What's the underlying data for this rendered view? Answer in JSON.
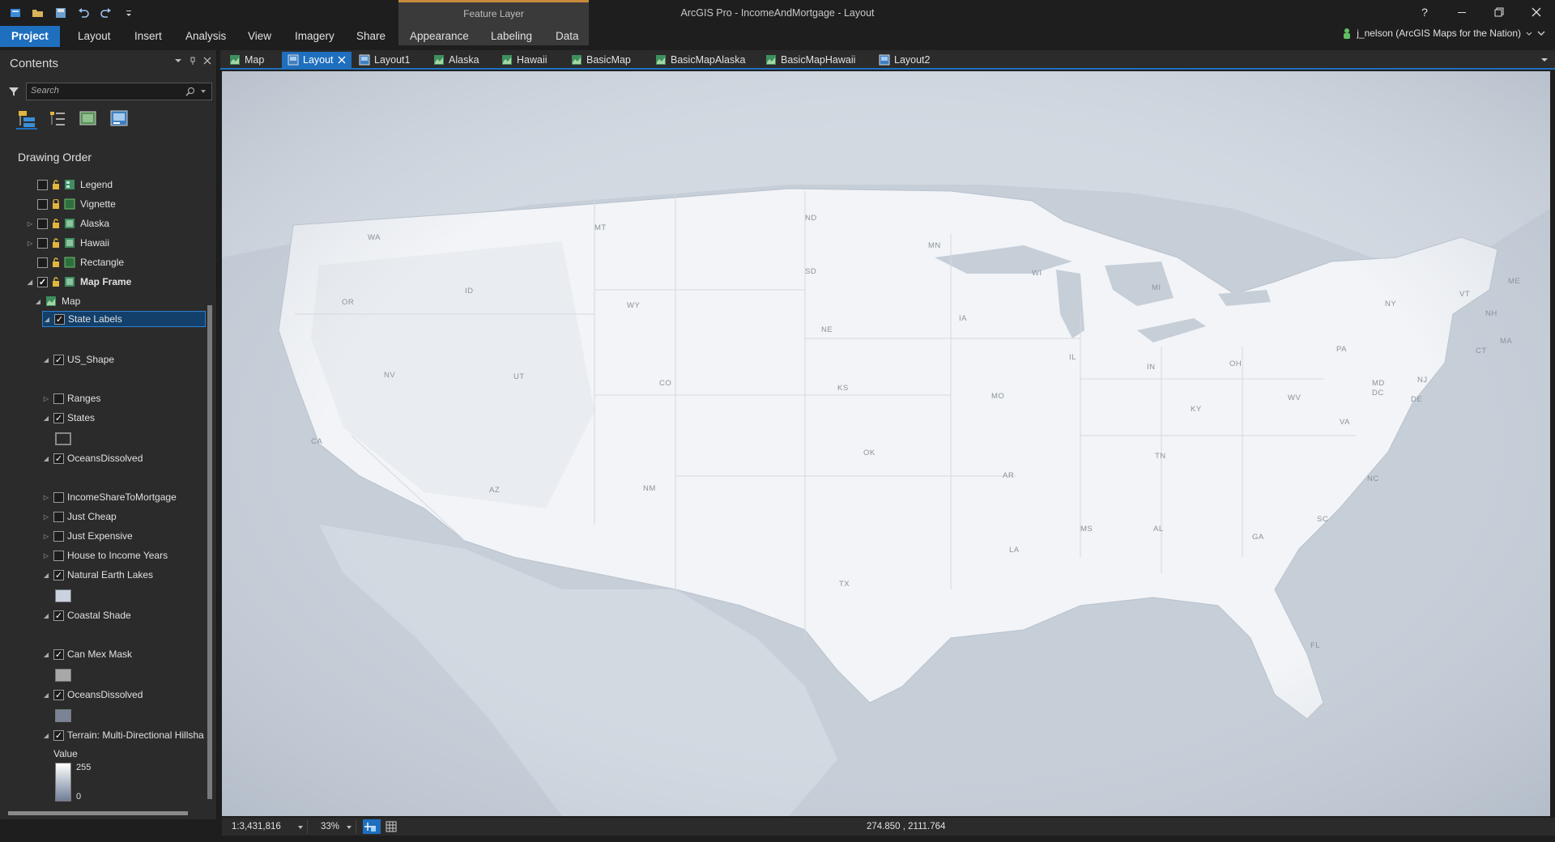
{
  "title_bar": {
    "app_title": "ArcGIS Pro - IncomeAndMortgage - Layout",
    "contextual_group": "Feature Layer",
    "help": "?"
  },
  "ribbon": {
    "tabs": [
      {
        "label": "Project",
        "active": true
      },
      {
        "label": "Layout"
      },
      {
        "label": "Insert"
      },
      {
        "label": "Analysis"
      },
      {
        "label": "View"
      },
      {
        "label": "Imagery"
      },
      {
        "label": "Share"
      },
      {
        "label": "Appearance"
      },
      {
        "label": "Labeling"
      },
      {
        "label": "Data"
      }
    ],
    "user": "j_nelson (ArcGIS Maps for the Nation)"
  },
  "contents": {
    "title": "Contents",
    "search_placeholder": "Search",
    "heading": "Drawing Order",
    "layers": [
      {
        "label": "Legend"
      },
      {
        "label": "Vignette"
      },
      {
        "label": "Alaska"
      },
      {
        "label": "Hawaii"
      },
      {
        "label": "Rectangle"
      },
      {
        "label": "Map Frame"
      },
      {
        "label": "Map"
      },
      {
        "label": "State Labels"
      },
      {
        "label": "US_Shape"
      },
      {
        "label": "Ranges"
      },
      {
        "label": "States"
      },
      {
        "label": "OceansDissolved"
      },
      {
        "label": "IncomeShareToMortgage"
      },
      {
        "label": "Just Cheap"
      },
      {
        "label": "Just Expensive"
      },
      {
        "label": "House to Income Years"
      },
      {
        "label": "Natural Earth Lakes"
      },
      {
        "label": "Coastal Shade"
      },
      {
        "label": "Can Mex Mask"
      },
      {
        "label": "OceansDissolved"
      },
      {
        "label": "Terrain: Multi-Directional Hillsha"
      }
    ],
    "legend_value_label": "Value",
    "legend_max": "255",
    "legend_min": "0"
  },
  "view_tabs": [
    {
      "label": "Map"
    },
    {
      "label": "Layout",
      "active": true
    },
    {
      "label": "Layout1"
    },
    {
      "label": "Alaska"
    },
    {
      "label": "Hawaii"
    },
    {
      "label": "BasicMap"
    },
    {
      "label": "BasicMapAlaska"
    },
    {
      "label": "BasicMapHawaii"
    },
    {
      "label": "Layout2"
    }
  ],
  "map": {
    "state_labels": [
      "WA",
      "MT",
      "ND",
      "MN",
      "OR",
      "ID",
      "WY",
      "SD",
      "WI",
      "MI",
      "NE",
      "IA",
      "NV",
      "UT",
      "CO",
      "IL",
      "IN",
      "OH",
      "PA",
      "NY",
      "VT",
      "NH",
      "ME",
      "MA",
      "CT",
      "NJ",
      "MD",
      "DE",
      "DC",
      "CA",
      "KS",
      "MO",
      "KY",
      "WV",
      "VA",
      "OK",
      "AZ",
      "NM",
      "AR",
      "TN",
      "NC",
      "SC",
      "MS",
      "AL",
      "GA",
      "LA",
      "TX",
      "FL"
    ]
  },
  "status": {
    "scale": "1:3,431,816",
    "zoom": "33%",
    "coordinates": "274.850 , 2111.764"
  },
  "colors": {
    "accent": "#1f6fbf",
    "contextual": "#c88a3a",
    "land": "#f2f4f7",
    "water": "#c4ccd6"
  }
}
